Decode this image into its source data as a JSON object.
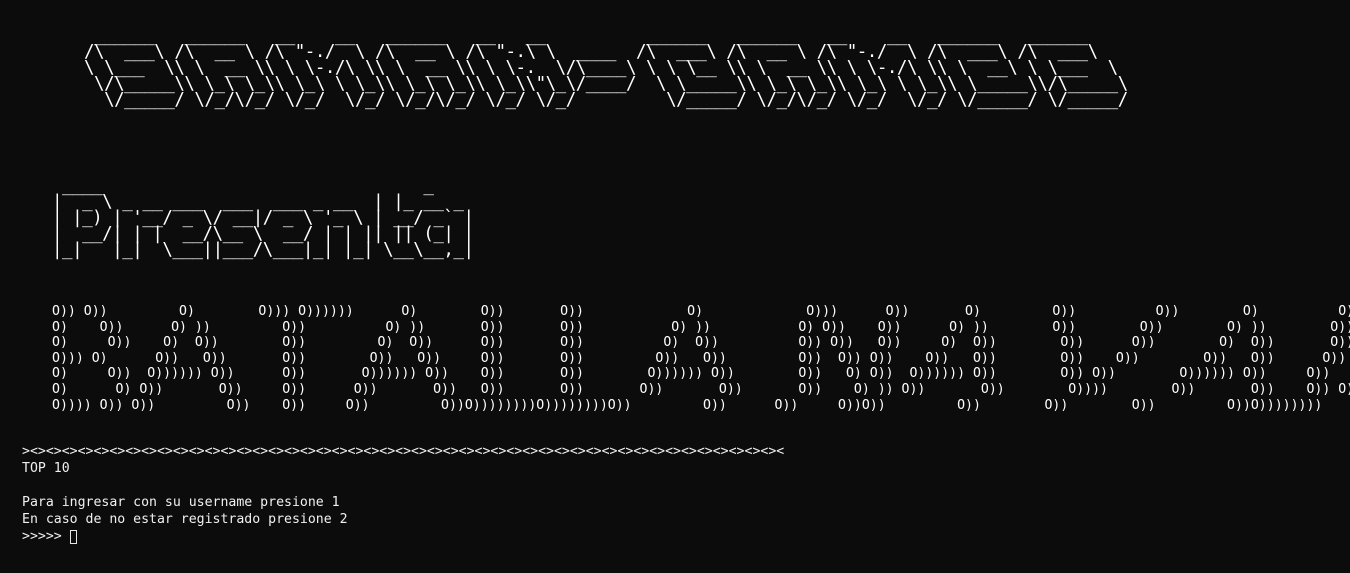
{
  "banner": {
    "title_art": " ______   ______   __    __   ______   __   __          ______   ______   __    __   ______   ______\n/\\  ___\\ /\\  __ \\ /\\ \"-./  \\ /\\  __ \\ /\\ \"-.\\ \\  ____  /\\  ___\\ /\\  __ \\ /\\ \"-./  \\ /\\  ___\\ /\\  ___\\\n\\ \\___  \\\\ \\  __ \\\\ \\ \\-./\\ \\\\ \\  __ \\\\ \\ \\-.  \\/\\____\\ \\ \\ \\__ \\\\ \\  __ \\\\ \\ \\-./\\ \\\\ \\  __\\ \\ \\___  \\\n \\/\\_____\\\\ \\_\\ \\_\\\\ \\_\\ \\ \\_\\\\ \\_\\ \\_\\\\ \\_\\\\\"\\_\\/____/  \\ \\_____\\\\ \\_\\ \\_\\\\ \\_\\ \\ \\_\\\\ \\_____\\\\/\\_____\\\n  \\/_____/ \\/_/\\/_/ \\/_/  \\/_/ \\/_/\\/_/ \\/_/ \\/_/         \\/_____/ \\/_/\\/_/ \\/_/  \\/_/ \\/_____/ \\/_____/",
    "presenta_art": " ____                                _\n|  _ \\ _ __ ___  ___  ___ _ __  | |_ __ _\n| |_) | '__/ _ \\/ __|/ _ \\ '_ \\ | __/ _` |\n|  __/| | |  __/\\__ \\  __/ | | || || (_| |\n|_|   |_|  \\___||___/\\___|_| |_| \\__\\__,_|",
    "batalla_art": "O)) O))         O)        O))) O))))))      O)        O))       O))             O)             O)))      O))       O)         O))          O))        O)          O))\nO)    O))      O) ))         O))          O) ))       O))       O))           O) ))           O) O))    O))      O) ))        O))        O))        O) ))        O))\nO)     O))    O)  O))        O))         O)  O))      O))       O))          O)  O))          O)) O))   O))     O)  O))        O))      O))        O)  O))       O))\nO))) O)      O))   O))       O))        O))   O))     O))       O))         O))   O))         O))  O)) O))    O))   O))        O))    O))        O))   O))      O))\nO)     O))  O)))))) O))      O))       O)))))) O))    O))       O))        O)))))) O))        O))   O) O))  O)))))) O))        O)) O))        O)))))) O))     O))\nO)      O) O))       O))     O))      O))       O))   O))       O))       O))       O))       O))    O) )) O))       O))        O))))        O))       O))    O)) O))\nO)))) O)) O))         O))    O))     O))         O))O))))))))O))))))))O))         O))      O))     O))O))         O))        O))        O))         O))O))))))))",
    "title_text": "SAMAN-GAMES",
    "presenta_text": "Presenta",
    "batalla_text": "BATALLA NAVAL"
  },
  "console": {
    "separator": "><><><><><><><><><><><><><><><><><><><><><><><><><><><><><><><><><><><><><><><><><><><><><><><><",
    "top10_label": "TOP 10",
    "blank": "",
    "option_1": "Para ingresar con su username presione 1",
    "option_2": "En caso de no estar registrado presione 2",
    "prompt": ">>>>>"
  },
  "colors": {
    "background": "#0c0c0c",
    "foreground": "#e6e6e6"
  }
}
